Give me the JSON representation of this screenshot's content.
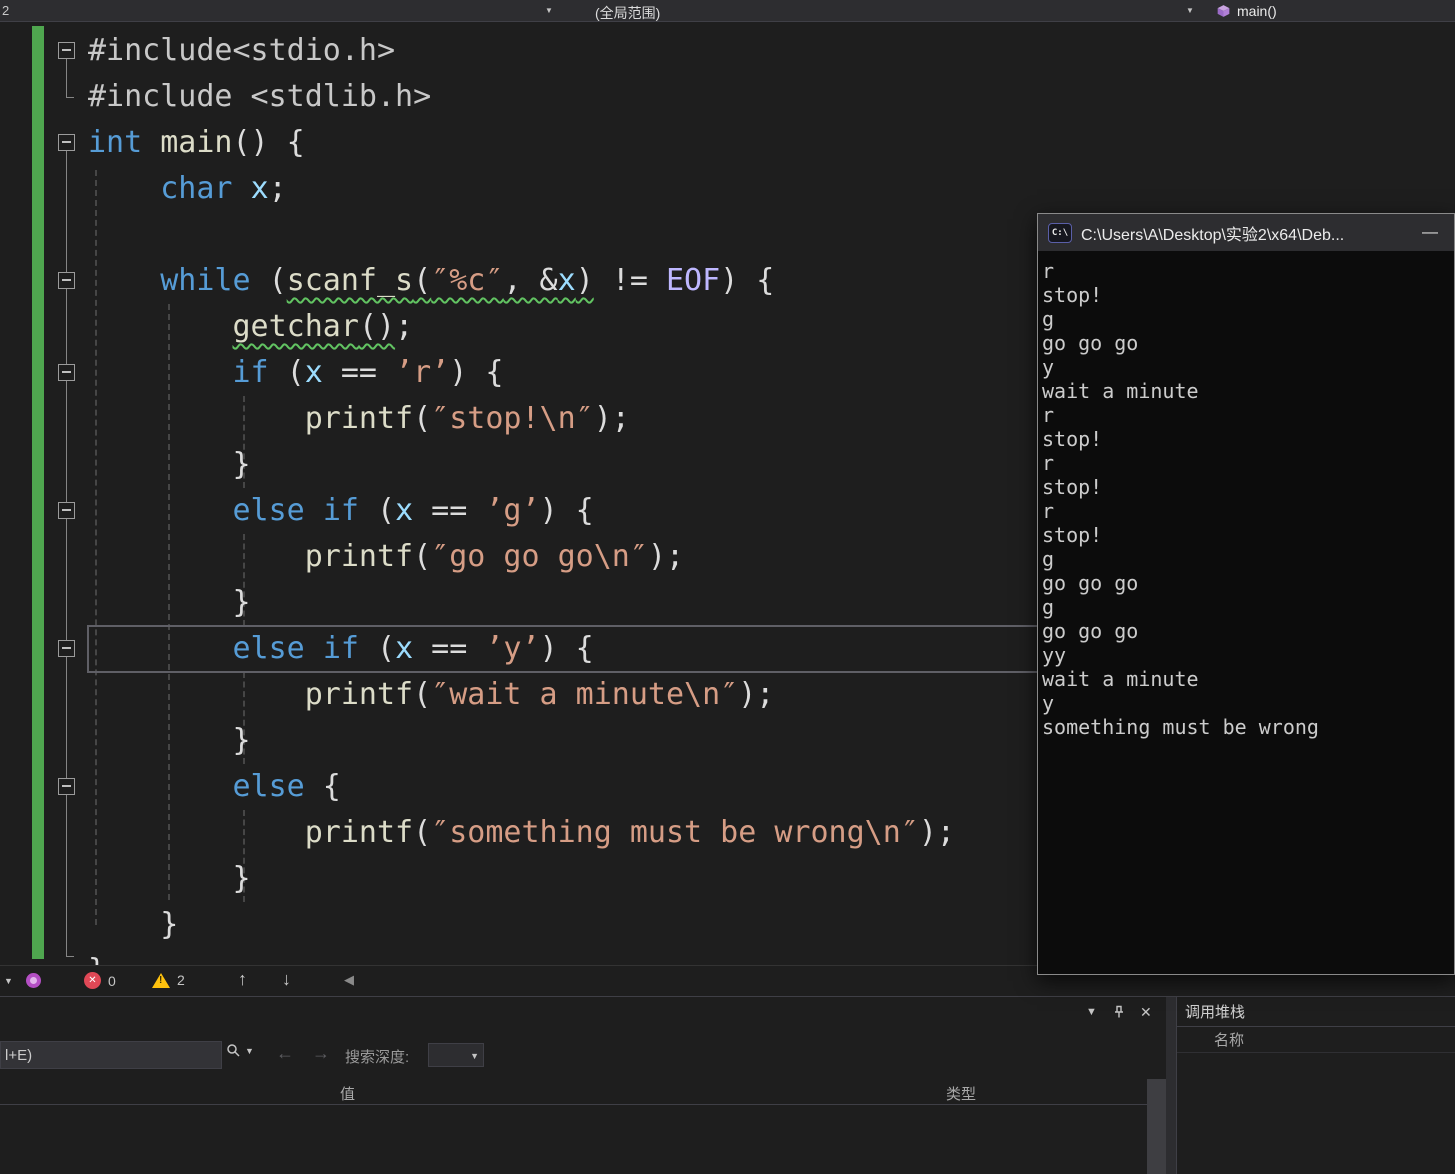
{
  "topbar": {
    "left_fragment": "2",
    "scope": "(全局范围)",
    "member": "main()"
  },
  "editor": {
    "lines": [
      {
        "fold": true,
        "tokens": [
          [
            "pp",
            "#include<stdio.h>"
          ]
        ]
      },
      {
        "fold": false,
        "tokens": [
          [
            "pp",
            "#include <stdlib.h>"
          ]
        ]
      },
      {
        "fold": true,
        "tokens": [
          [
            "kw",
            "int"
          ],
          [
            "pl",
            " "
          ],
          [
            "fn",
            "main"
          ],
          [
            "pl",
            "() {"
          ]
        ]
      },
      {
        "fold": false,
        "tokens": [
          [
            "pl",
            "    "
          ],
          [
            "kw",
            "char"
          ],
          [
            "pl",
            " "
          ],
          [
            "var",
            "x"
          ],
          [
            "pl",
            ";"
          ]
        ]
      },
      {
        "fold": false,
        "tokens": []
      },
      {
        "fold": true,
        "tokens": [
          [
            "pl",
            "    "
          ],
          [
            "kw",
            "while"
          ],
          [
            "pl",
            " ("
          ],
          [
            "fn sq",
            "scanf_s"
          ],
          [
            "pl sq",
            "("
          ],
          [
            "str sq",
            "″%c″"
          ],
          [
            "pl sq",
            ", &"
          ],
          [
            "var sq",
            "x"
          ],
          [
            "pl sq",
            ")"
          ],
          [
            "pl",
            " != "
          ],
          [
            "mac",
            "EOF"
          ],
          [
            "pl",
            ") {"
          ]
        ]
      },
      {
        "fold": false,
        "tokens": [
          [
            "pl",
            "        "
          ],
          [
            "fn sq",
            "getchar"
          ],
          [
            "pl sq",
            "()"
          ],
          [
            "pl",
            ";"
          ]
        ]
      },
      {
        "fold": true,
        "tokens": [
          [
            "pl",
            "        "
          ],
          [
            "kw",
            "if"
          ],
          [
            "pl",
            " ("
          ],
          [
            "var",
            "x"
          ],
          [
            "pl",
            " == "
          ],
          [
            "str",
            "’r’"
          ],
          [
            "pl",
            ") {"
          ]
        ]
      },
      {
        "fold": false,
        "tokens": [
          [
            "pl",
            "            "
          ],
          [
            "fn",
            "printf"
          ],
          [
            "pl",
            "("
          ],
          [
            "str",
            "″stop!\\n″"
          ],
          [
            "pl",
            ");"
          ]
        ]
      },
      {
        "fold": false,
        "tokens": [
          [
            "pl",
            "        }"
          ]
        ]
      },
      {
        "fold": true,
        "tokens": [
          [
            "pl",
            "        "
          ],
          [
            "kw",
            "else"
          ],
          [
            "pl",
            " "
          ],
          [
            "kw",
            "if"
          ],
          [
            "pl",
            " ("
          ],
          [
            "var",
            "x"
          ],
          [
            "pl",
            " == "
          ],
          [
            "str",
            "’g’"
          ],
          [
            "pl",
            ") {"
          ]
        ]
      },
      {
        "fold": false,
        "tokens": [
          [
            "pl",
            "            "
          ],
          [
            "fn",
            "printf"
          ],
          [
            "pl",
            "("
          ],
          [
            "str",
            "″go go go\\n″"
          ],
          [
            "pl",
            ");"
          ]
        ]
      },
      {
        "fold": false,
        "tokens": [
          [
            "pl",
            "        }"
          ]
        ]
      },
      {
        "fold": true,
        "current": true,
        "tokens": [
          [
            "pl",
            "        "
          ],
          [
            "kw",
            "else"
          ],
          [
            "pl",
            " "
          ],
          [
            "kw",
            "if"
          ],
          [
            "pl",
            " ("
          ],
          [
            "var",
            "x"
          ],
          [
            "pl",
            " == "
          ],
          [
            "str",
            "’y’"
          ],
          [
            "pl",
            ") {"
          ]
        ]
      },
      {
        "fold": false,
        "tokens": [
          [
            "pl",
            "            "
          ],
          [
            "fn",
            "printf"
          ],
          [
            "pl",
            "("
          ],
          [
            "str",
            "″wait a minute\\n″"
          ],
          [
            "pl",
            ");"
          ]
        ]
      },
      {
        "fold": false,
        "tokens": [
          [
            "pl",
            "        }"
          ]
        ]
      },
      {
        "fold": true,
        "tokens": [
          [
            "pl",
            "        "
          ],
          [
            "kw",
            "else"
          ],
          [
            "pl",
            " {"
          ]
        ]
      },
      {
        "fold": false,
        "tokens": [
          [
            "pl",
            "            "
          ],
          [
            "fn",
            "printf"
          ],
          [
            "pl",
            "("
          ],
          [
            "str",
            "″something must be wrong\\n″"
          ],
          [
            "pl",
            ");"
          ]
        ]
      },
      {
        "fold": false,
        "tokens": [
          [
            "pl",
            "        }"
          ]
        ]
      },
      {
        "fold": false,
        "tokens": [
          [
            "pl",
            "    }"
          ]
        ]
      },
      {
        "fold": false,
        "tokens": [
          [
            "pl",
            "}"
          ]
        ]
      }
    ]
  },
  "console": {
    "icon_label": "C:\\",
    "title": "C:\\Users\\A\\Desktop\\实验2\\x64\\Deb...",
    "lines": [
      "r",
      "stop!",
      "g",
      "go go go",
      "y",
      "wait a minute",
      "r",
      "stop!",
      "r",
      "stop!",
      "r",
      "stop!",
      "g",
      "go go go",
      "g",
      "go go go",
      "yy",
      "wait a minute",
      "y",
      "something must be wrong"
    ]
  },
  "statusbar": {
    "error_count": "0",
    "warning_count": "2"
  },
  "watch_panel": {
    "search_value": "l+E)",
    "search_depth_label": "搜索深度:",
    "columns": {
      "value": "值",
      "type": "类型"
    }
  },
  "callstack_panel": {
    "title": "调用堆栈",
    "column_name": "名称"
  },
  "icons": {
    "caret_down": "▼",
    "up_arrow": "↑",
    "down_arrow": "↓",
    "left_triangle": "◀",
    "close": "✕",
    "error_x": "✕",
    "arrow_left": "←",
    "arrow_right": "→",
    "minimize": "—"
  }
}
